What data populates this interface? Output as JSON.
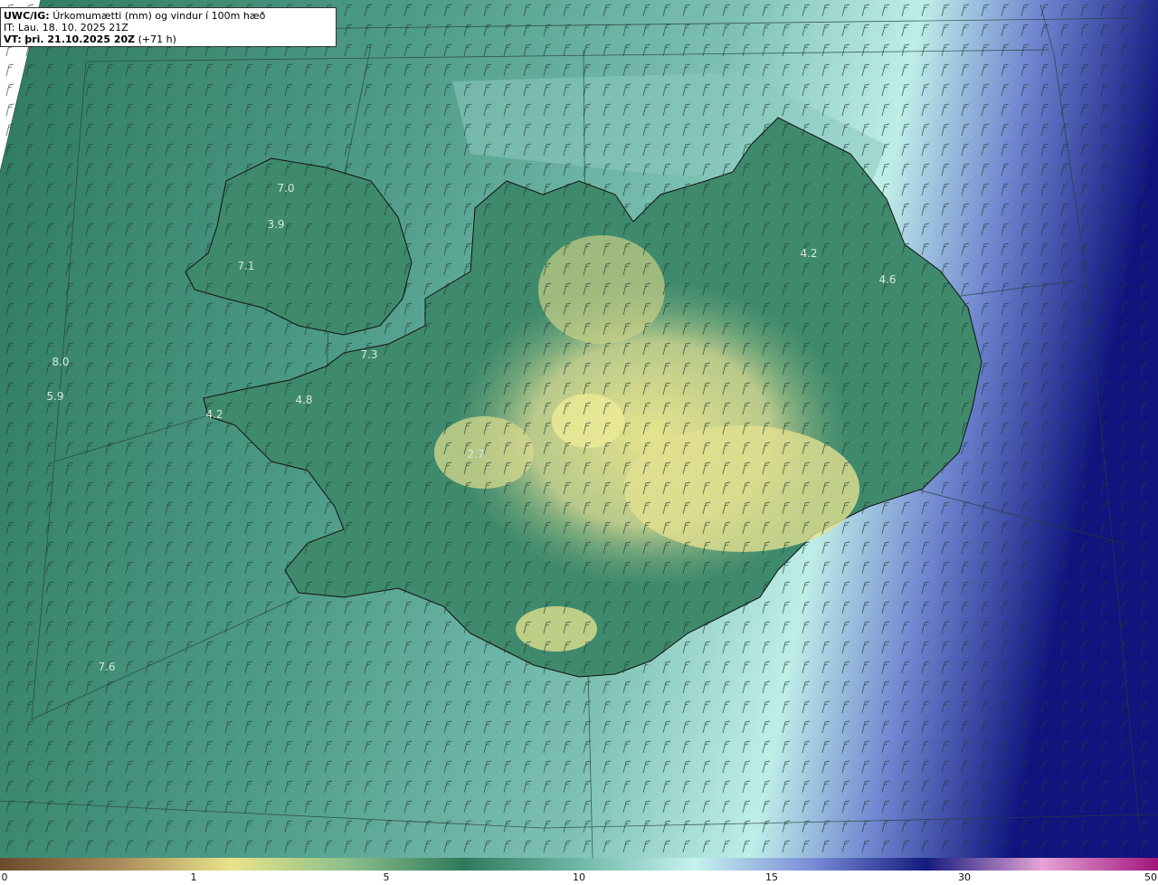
{
  "header": {
    "model": "UWC/IG:",
    "title": "Úrkomumætti (mm) og vindur í 100m hæð",
    "it_label": "IT:",
    "it_value": "Lau. 18. 10. 2025 21Z",
    "vt_label": "VT:",
    "vt_value": "þri. 21.10.2025 20Z",
    "vt_offset": "(+71 h)"
  },
  "map_labels": [
    {
      "text": "7.0"
    },
    {
      "text": "3.9"
    },
    {
      "text": "7.1"
    },
    {
      "text": "7.3"
    },
    {
      "text": "8.0"
    },
    {
      "text": "5.9"
    },
    {
      "text": "4.8"
    },
    {
      "text": "4.2"
    },
    {
      "text": "2.7"
    },
    {
      "text": "4.2"
    },
    {
      "text": "4.6"
    },
    {
      "text": "7.6"
    }
  ],
  "colorbar": {
    "ticks": [
      "0",
      "1",
      "5",
      "10",
      "15",
      "30",
      "50"
    ],
    "colors": [
      "#6b4a2c",
      "#a8895a",
      "#e9e38a",
      "#8cc08a",
      "#2f7a5c",
      "#6fb8a8",
      "#c6f2ee",
      "#7a8ed8",
      "#141a7e",
      "#e6a3d6",
      "#a0157c"
    ]
  },
  "colors": {
    "ocean": "#5fa898",
    "land_low": "#3f8a6c",
    "land_high": "#d9d98b",
    "heavy": "#0b0f86"
  }
}
